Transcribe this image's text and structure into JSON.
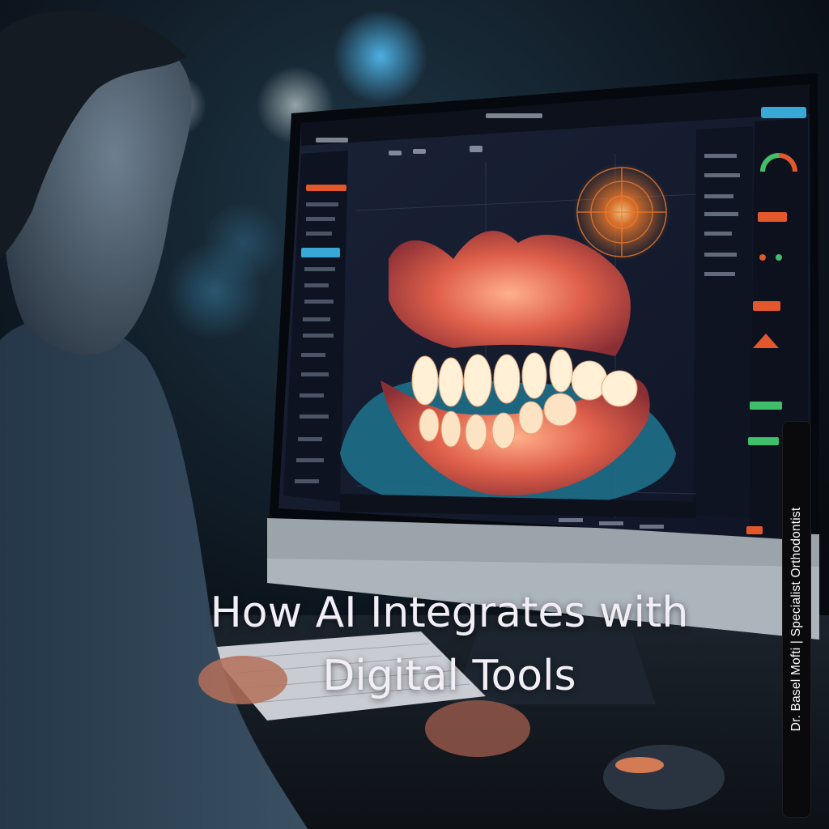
{
  "headline": {
    "line1": "How AI Integrates with",
    "line2": "Digital Tools"
  },
  "side_label": "Dr. Basel Mofti | Specialist Orthodontist",
  "colors": {
    "background": "#0b1118",
    "screen": "#141b2e",
    "accent_orange": "#e2572b",
    "accent_cyan": "#38a9d6",
    "gum_glow": "#e86a52"
  }
}
